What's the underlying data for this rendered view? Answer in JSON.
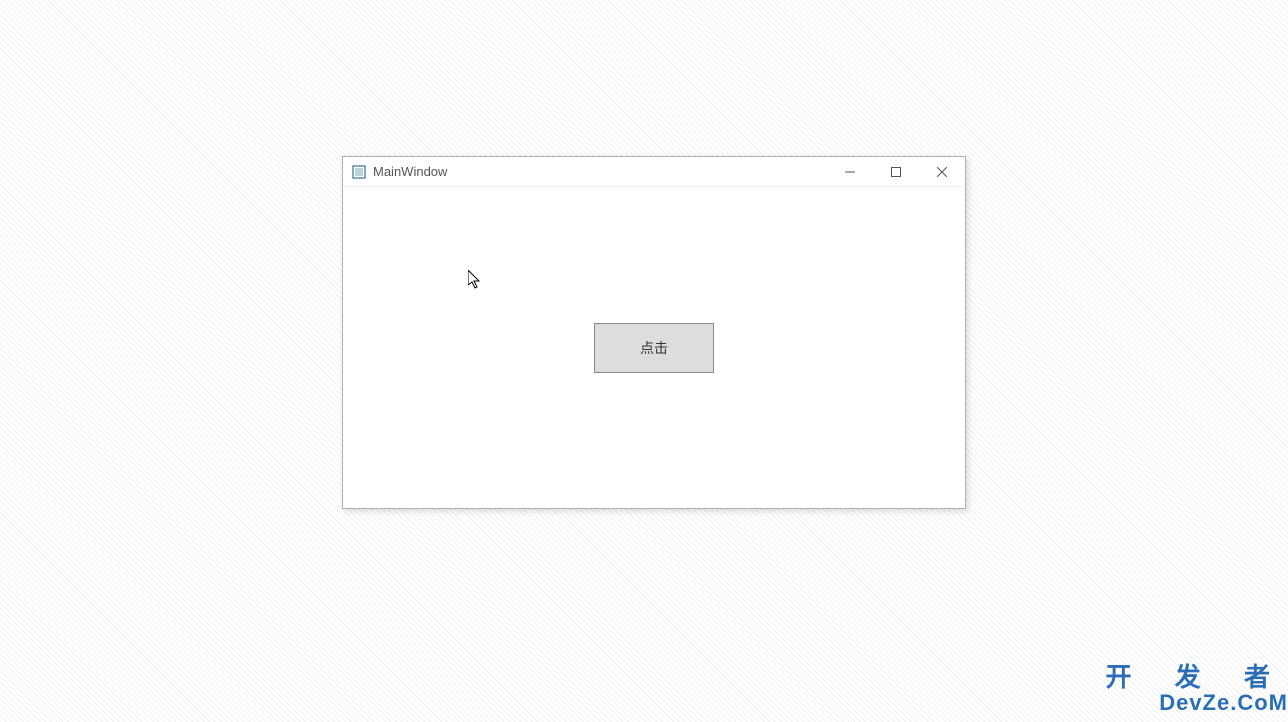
{
  "window": {
    "title": "MainWindow",
    "controls": {
      "minimize": "minimize",
      "maximize": "maximize",
      "close": "close"
    }
  },
  "content": {
    "button_label": "点击"
  },
  "watermark": {
    "line1": "开 发 者",
    "line2": "DevZe.CoM"
  }
}
